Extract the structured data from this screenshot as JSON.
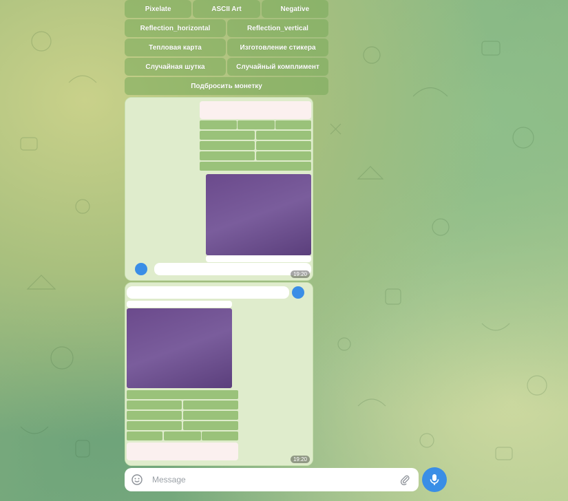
{
  "keyboard": {
    "rows": [
      [
        "Pixelate",
        "ASCII Art",
        "Negative"
      ],
      [
        "Reflection_horizontal",
        "Reflection_vertical"
      ],
      [
        "Тепловая карта",
        "Изготовление стикера"
      ],
      [
        "Случайная шутка",
        "Случайный комплимент"
      ],
      [
        "Подбросить монетку"
      ]
    ]
  },
  "messages": [
    {
      "time": "19:20"
    },
    {
      "time": "19:20"
    }
  ],
  "composer": {
    "placeholder": "Message"
  },
  "icons": {
    "emoji": "emoji-icon",
    "attach": "paperclip-icon",
    "mic": "microphone-icon"
  },
  "colors": {
    "accent": "#3a8ee6",
    "bubble": "#e9f7d9",
    "keyboard_button": "#78aa5a"
  }
}
